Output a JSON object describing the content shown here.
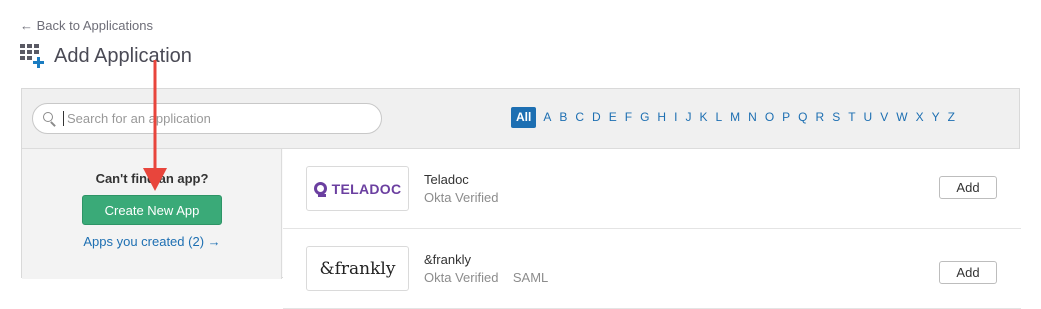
{
  "nav": {
    "back_label": "← Back to Applications"
  },
  "header": {
    "title": "Add Application"
  },
  "search": {
    "placeholder": "Search for an application"
  },
  "alphabet": [
    "All",
    "A",
    "B",
    "C",
    "D",
    "E",
    "F",
    "G",
    "H",
    "I",
    "J",
    "K",
    "L",
    "M",
    "N",
    "O",
    "P",
    "Q",
    "R",
    "S",
    "T",
    "U",
    "V",
    "W",
    "X",
    "Y",
    "Z"
  ],
  "sidebar": {
    "cant_find": "Can't find an app?",
    "create_button": "Create New App",
    "apps_created_link": "Apps you created (2) →"
  },
  "apps": [
    {
      "name": "Teladoc",
      "subtitle": "Okta Verified",
      "logo_text": "TELADOC",
      "add_label": "Add"
    },
    {
      "name": "&frankly",
      "subtitle": "Okta Verified    SAML",
      "logo_text": "&frankly",
      "add_label": "Add"
    }
  ],
  "colors": {
    "link": "#1d6fb2",
    "primary_button": "#3aaa78",
    "annotation_arrow": "#e8453c"
  }
}
